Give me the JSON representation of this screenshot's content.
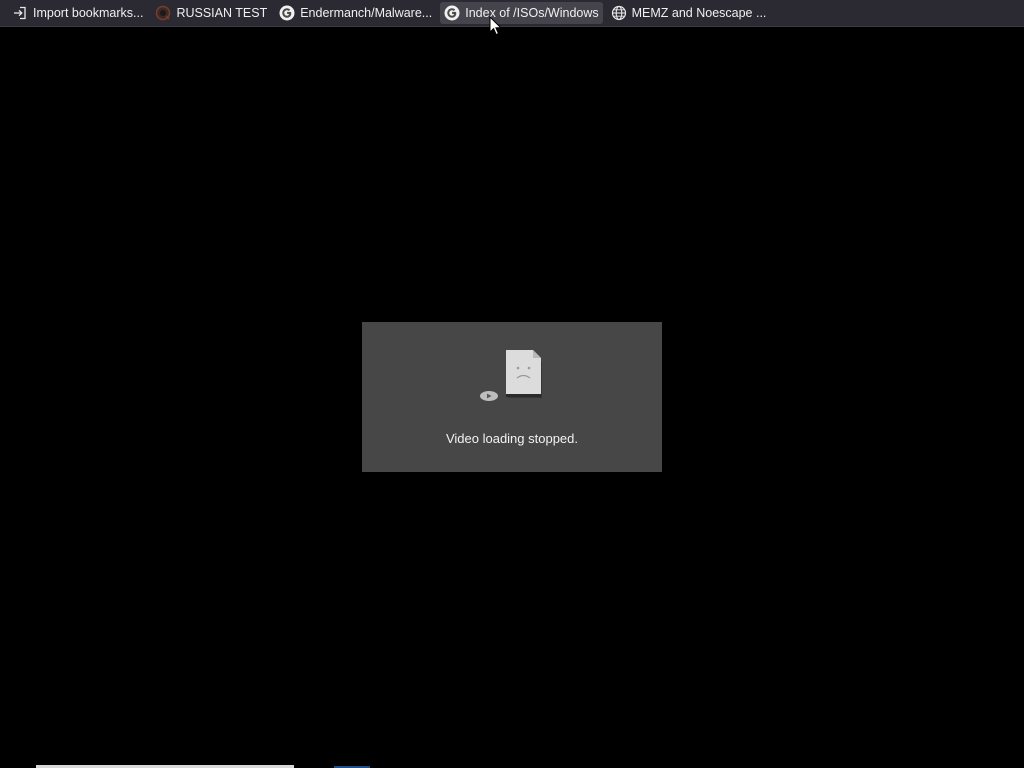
{
  "bookmarks_bar": {
    "items": [
      {
        "label": "Import bookmarks...",
        "icon": "import-icon"
      },
      {
        "label": "RUSSIAN TEST",
        "icon": "site-favicon-icon"
      },
      {
        "label": "Endermanch/Malware...",
        "icon": "google-icon"
      },
      {
        "label": "Index of /ISOs/Windows",
        "icon": "google-icon",
        "hovered": true
      },
      {
        "label": "MEMZ and Noescape ...",
        "icon": "globe-icon"
      }
    ]
  },
  "video": {
    "error_message": "Video loading stopped.",
    "icon": "broken-video-file-icon"
  },
  "colors": {
    "toolbar_bg": "#2b2a33",
    "page_bg": "#000000",
    "panel_bg": "#474747",
    "text": "#f0f0f0"
  }
}
